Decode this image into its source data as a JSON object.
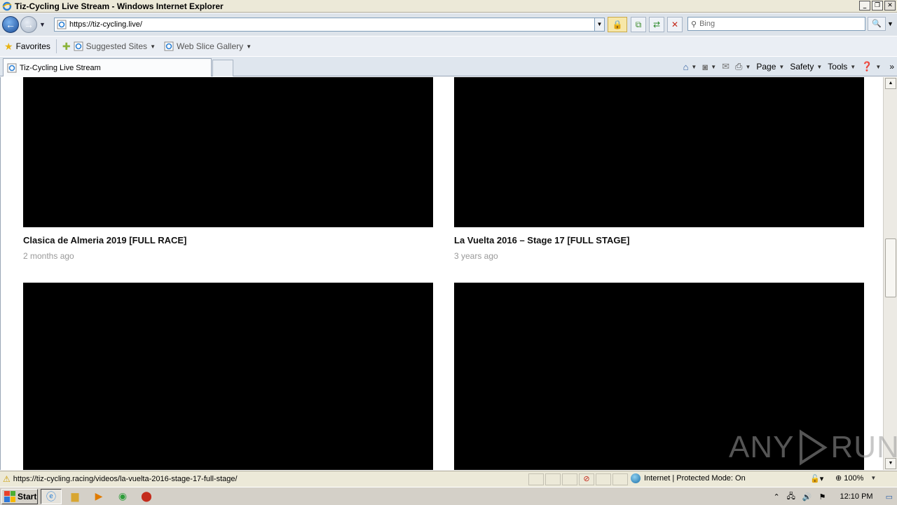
{
  "window": {
    "title": "Tiz-Cycling Live Stream - Windows Internet Explorer",
    "min_glyph": "_",
    "max_glyph": "❐",
    "close_glyph": "✕"
  },
  "address_bar": {
    "url": "https://tiz-cycling.live/",
    "search_placeholder": "Bing"
  },
  "favorites_bar": {
    "favorites_label": "Favorites",
    "items": [
      {
        "label": "Suggested Sites"
      },
      {
        "label": "Web Slice Gallery"
      }
    ]
  },
  "tab": {
    "label": "Tiz-Cycling Live Stream"
  },
  "command_bar": {
    "page_label": "Page",
    "safety_label": "Safety",
    "tools_label": "Tools"
  },
  "content": {
    "cards": [
      {
        "title": "Clasica de Almeria 2019 [FULL RACE]",
        "meta": "2 months ago"
      },
      {
        "title": "La Vuelta 2016 – Stage 17 [FULL STAGE]",
        "meta": "3 years ago"
      },
      {
        "title": "",
        "meta": ""
      },
      {
        "title": "",
        "meta": ""
      }
    ],
    "thumbnail_color": "#000000"
  },
  "watermark": {
    "left": "ANY",
    "right": "RUN"
  },
  "status_bar": {
    "url": "https://tiz-cycling.racing/videos/la-vuelta-2016-stage-17-full-stage/",
    "zone": "Internet | Protected Mode: On",
    "zoom": "100%"
  },
  "taskbar": {
    "start_label": "Start",
    "clock": "12:10 PM"
  },
  "colors": {
    "accent_ie_blue": "#1b4e99",
    "lock_yellow": "#f7e7a8"
  }
}
